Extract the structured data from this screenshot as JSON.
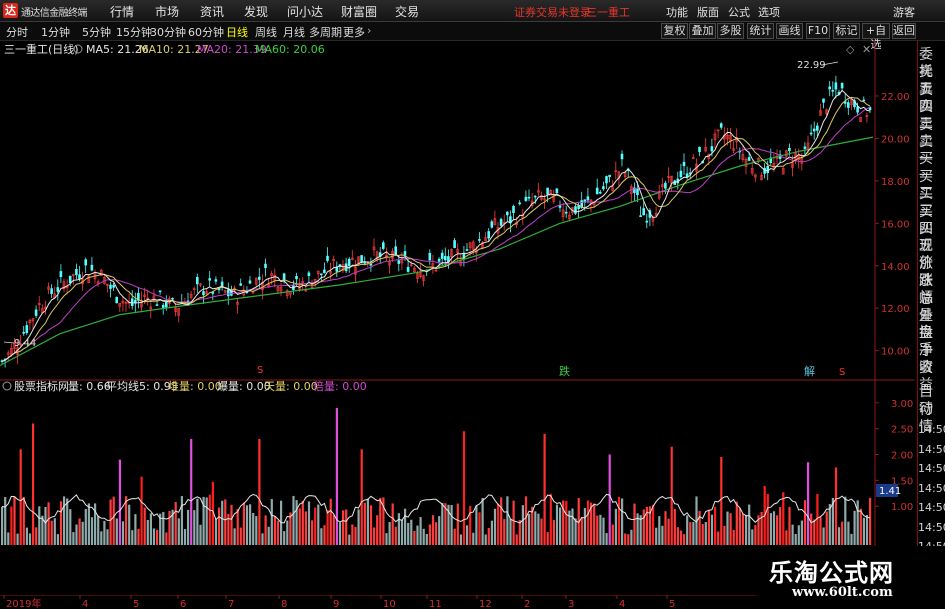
{
  "app": {
    "title": "通达信金融终端",
    "logo": "达"
  },
  "menu": [
    "行情",
    "市场",
    "资讯",
    "发现",
    "问小达",
    "财富圈",
    "交易"
  ],
  "status": {
    "login": "证券交易未登录",
    "stock": "三一重工"
  },
  "right_menu": [
    "功能",
    "版面",
    "公式",
    "选项"
  ],
  "guest": "游客",
  "periods": [
    "分时",
    "1分钟",
    "5分钟",
    "15分钟",
    "30分钟",
    "60分钟",
    "日线",
    "周线",
    "月线",
    "多周期",
    "更多"
  ],
  "selected_period": "日线",
  "tools": [
    "复权",
    "叠加",
    "多股",
    "统计",
    "画线",
    "F10",
    "标记",
    "+自选",
    "返回"
  ],
  "chart_header": {
    "stock_label": "三一重工(日线)",
    "ma5": "MA5: 21.26",
    "ma10": "MA10: 21.27",
    "ma20": "MA20: 21.39",
    "ma60": "MA60: 20.06"
  },
  "indicator_header": {
    "name": "股票指标网",
    "vol": "量: 0.66",
    "avg": "平均线5: 0.93",
    "dui": "堆量: 0.00",
    "bao": "爆量: 0.00",
    "tian": "天量: 0.00",
    "bei": "倍量: 0.00"
  },
  "right_panel": [
    "委托",
    "卖五",
    "卖四",
    "卖三",
    "卖二",
    "卖一",
    "买一",
    "买二",
    "买三",
    "买四",
    "买五",
    "现价",
    "涨跌",
    "涨幅",
    "总量",
    "外盘",
    "换手",
    "净资",
    "收益",
    "自动",
    "行情",
    "14:50",
    "14:50",
    "14:50",
    "14:50",
    "14:50",
    "14:50",
    "14:50",
    "14:50"
  ],
  "markers": {
    "high": "22.99",
    "low": "9.44",
    "s1": "S",
    "die": "跌",
    "jie": "解",
    "s2": "S"
  },
  "watermark": {
    "title": "乐淘公式网",
    "url": "www.60lt.com"
  },
  "chart_data": [
    {
      "type": "candlestick",
      "yticks": [
        "22.00",
        "20.00",
        "18.00",
        "16.00",
        "14.00",
        "12.00",
        "10.00"
      ],
      "xlabels": [
        "2019年",
        "4",
        "5",
        "6",
        "7",
        "8",
        "9",
        "10",
        "11",
        "12",
        "2",
        "3",
        "4",
        "5"
      ],
      "ylim": [
        8.9,
        23.6
      ],
      "high": 22.99,
      "low": 9.44,
      "close_path": [
        [
          0,
          9.4
        ],
        [
          12,
          10.0
        ],
        [
          25,
          11.0
        ],
        [
          40,
          12.2
        ],
        [
          55,
          12.9
        ],
        [
          70,
          13.4
        ],
        [
          85,
          13.9
        ],
        [
          100,
          13.6
        ],
        [
          115,
          12.7
        ],
        [
          130,
          12.1
        ],
        [
          145,
          12.5
        ],
        [
          160,
          12.4
        ],
        [
          175,
          12.0
        ],
        [
          190,
          12.6
        ],
        [
          205,
          13.0
        ],
        [
          220,
          12.8
        ],
        [
          235,
          12.6
        ],
        [
          250,
          13.1
        ],
        [
          265,
          13.6
        ],
        [
          280,
          13.4
        ],
        [
          295,
          13.0
        ],
        [
          310,
          13.3
        ],
        [
          330,
          13.9
        ],
        [
          345,
          14.2
        ],
        [
          360,
          14.3
        ],
        [
          375,
          14.5
        ],
        [
          390,
          14.3
        ],
        [
          405,
          14.2
        ],
        [
          420,
          13.9
        ],
        [
          435,
          14.0
        ],
        [
          450,
          14.3
        ],
        [
          465,
          14.7
        ],
        [
          480,
          15.2
        ],
        [
          495,
          15.8
        ],
        [
          510,
          16.2
        ],
        [
          525,
          16.8
        ],
        [
          540,
          17.2
        ],
        [
          555,
          17.1
        ],
        [
          570,
          16.6
        ],
        [
          585,
          16.8
        ],
        [
          600,
          17.5
        ],
        [
          612,
          18.0
        ],
        [
          622,
          18.7
        ],
        [
          632,
          17.8
        ],
        [
          642,
          16.4
        ],
        [
          652,
          16.6
        ],
        [
          665,
          17.6
        ],
        [
          680,
          18.3
        ],
        [
          695,
          18.8
        ],
        [
          710,
          19.5
        ],
        [
          722,
          20.2
        ],
        [
          735,
          19.8
        ],
        [
          748,
          18.9
        ],
        [
          760,
          18.6
        ],
        [
          775,
          18.7
        ],
        [
          790,
          19.2
        ],
        [
          805,
          19.1
        ],
        [
          815,
          20.5
        ],
        [
          825,
          21.6
        ],
        [
          838,
          22.4
        ],
        [
          850,
          21.8
        ],
        [
          862,
          21.4
        ],
        [
          873,
          21.2
        ]
      ],
      "ma60_path": [
        [
          0,
          9.3
        ],
        [
          60,
          10.8
        ],
        [
          120,
          11.7
        ],
        [
          180,
          12.1
        ],
        [
          260,
          12.6
        ],
        [
          340,
          13.1
        ],
        [
          420,
          13.7
        ],
        [
          500,
          14.8
        ],
        [
          560,
          16.0
        ],
        [
          620,
          16.8
        ],
        [
          680,
          17.8
        ],
        [
          740,
          18.7
        ],
        [
          800,
          19.4
        ],
        [
          873,
          20.06
        ]
      ]
    },
    {
      "type": "bar",
      "yticks": [
        "3.00",
        "2.50",
        "2.00",
        "1.50",
        "1.00"
      ],
      "ylim": [
        0.25,
        3.15
      ],
      "current": "1.41",
      "series": [
        "量",
        "平均线5",
        "堆量",
        "爆量",
        "天量",
        "倍量"
      ]
    }
  ]
}
